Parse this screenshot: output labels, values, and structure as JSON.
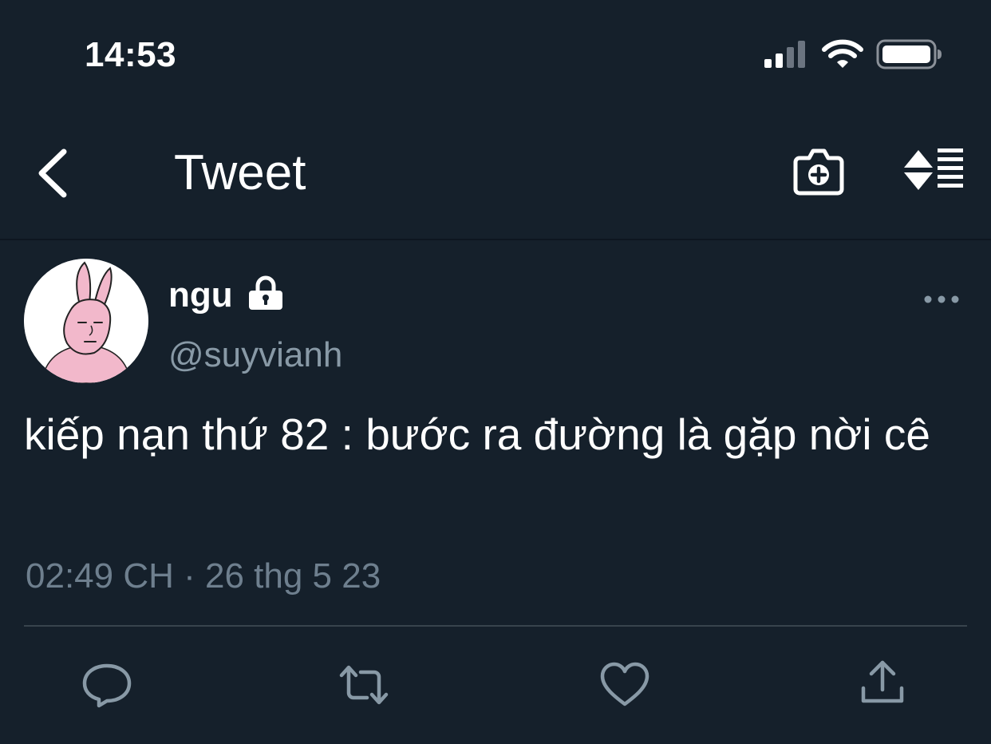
{
  "status_bar": {
    "time": "14:53",
    "icons": [
      "signal-icon",
      "wifi-icon",
      "battery-icon"
    ]
  },
  "nav": {
    "title": "Tweet",
    "back_icon": "chevron-left-icon",
    "actions": [
      "camera-plus-icon",
      "sort-icon"
    ]
  },
  "tweet": {
    "author": {
      "display_name": "ngu",
      "handle": "@suyvianh",
      "protected_icon": "lock-icon"
    },
    "text": "kiếp nạn thứ 82 : bước ra đường là gặp nời cê",
    "timestamp": "02:49 CH · 26 thg 5 23",
    "more_icon": "more-horizontal-icon"
  },
  "actions": [
    "reply-icon",
    "retweet-icon",
    "like-icon",
    "share-icon"
  ],
  "colors": {
    "background": "#15202b",
    "text_primary": "#ffffff",
    "text_secondary": "#8899a6",
    "divider": "#38444d",
    "icon_gray": "#8899a6"
  }
}
